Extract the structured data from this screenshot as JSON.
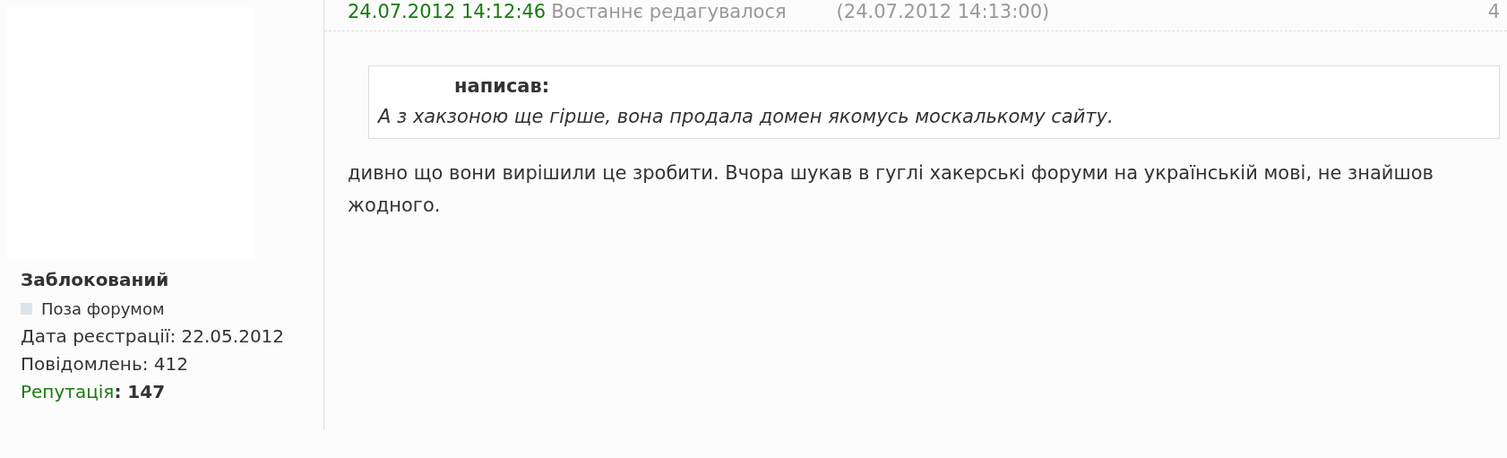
{
  "user": {
    "rank": "Заблокований",
    "online": false,
    "status": "Поза форумом",
    "details": [
      "Дата реєстрації: 22.05.2012",
      "Повідомлень: 412"
    ],
    "reputation_label": "Репутація",
    "reputation_value": ": 147"
  },
  "post": {
    "posted": "24.07.2012 14:12:46",
    "edited_label": "Востаннє редагувалося",
    "edited_time": "(24.07.2012 14:13:00)",
    "number": "4",
    "quote": {
      "author": "написав:",
      "text": "А з хакзоною ще гірше, вона продала домен якомусь москалькому сайту."
    },
    "body": "дивно що вони вирішили це зробити. Вчора шукав в гуглі хакерські форуми на українській мові, не знайшов жодного."
  }
}
